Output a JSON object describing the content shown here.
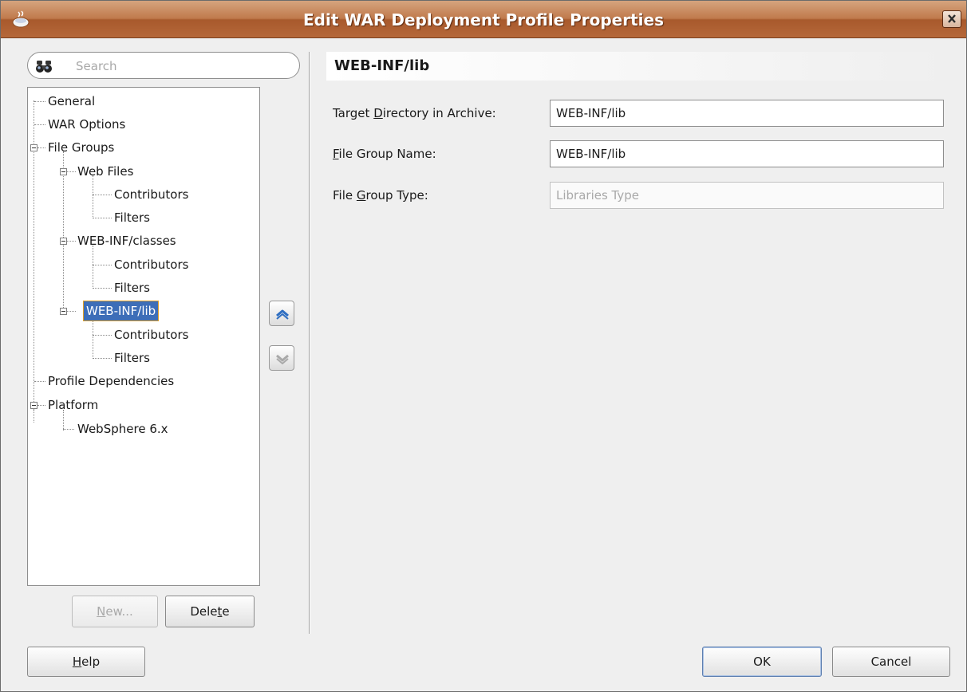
{
  "window": {
    "title": "Edit WAR Deployment Profile Properties"
  },
  "search": {
    "placeholder": "Search"
  },
  "tree": {
    "general": "General",
    "war_options": "WAR Options",
    "file_groups": "File Groups",
    "web_files": "Web Files",
    "web_files_contributors": "Contributors",
    "web_files_filters": "Filters",
    "web_inf_classes": "WEB-INF/classes",
    "classes_contributors": "Contributors",
    "classes_filters": "Filters",
    "web_inf_lib": "WEB-INF/lib",
    "lib_contributors": "Contributors",
    "lib_filters": "Filters",
    "profile_dependencies": "Profile Dependencies",
    "platform": "Platform",
    "websphere": "WebSphere 6.x",
    "selected": "WEB-INF/lib"
  },
  "tree_buttons": {
    "new_pre": "",
    "new_mnemonic": "N",
    "new_post": "ew...",
    "delete_pre": "Dele",
    "delete_mnemonic": "t",
    "delete_post": "e"
  },
  "move_buttons": {
    "up_icon": "chevron-up-icon",
    "down_icon": "chevron-down-icon"
  },
  "panel": {
    "title": "WEB-INF/lib",
    "target_dir": {
      "label_pre": "Target ",
      "label_mnemonic": "D",
      "label_post": "irectory in Archive:",
      "value": "WEB-INF/lib"
    },
    "file_group_name": {
      "label_pre": "",
      "label_mnemonic": "F",
      "label_post": "ile Group Name:",
      "value": "WEB-INF/lib"
    },
    "file_group_type": {
      "label_pre": "File ",
      "label_mnemonic": "G",
      "label_post": "roup Type:",
      "value": "Libraries Type"
    }
  },
  "footer": {
    "help_pre": "",
    "help_mnemonic": "H",
    "help_post": "elp",
    "ok": "OK",
    "cancel": "Cancel"
  },
  "colors": {
    "titlebar": "#b5683a",
    "selection": "#3d6eb8",
    "selection_outline": "#e0a12a",
    "background": "#efefef"
  }
}
